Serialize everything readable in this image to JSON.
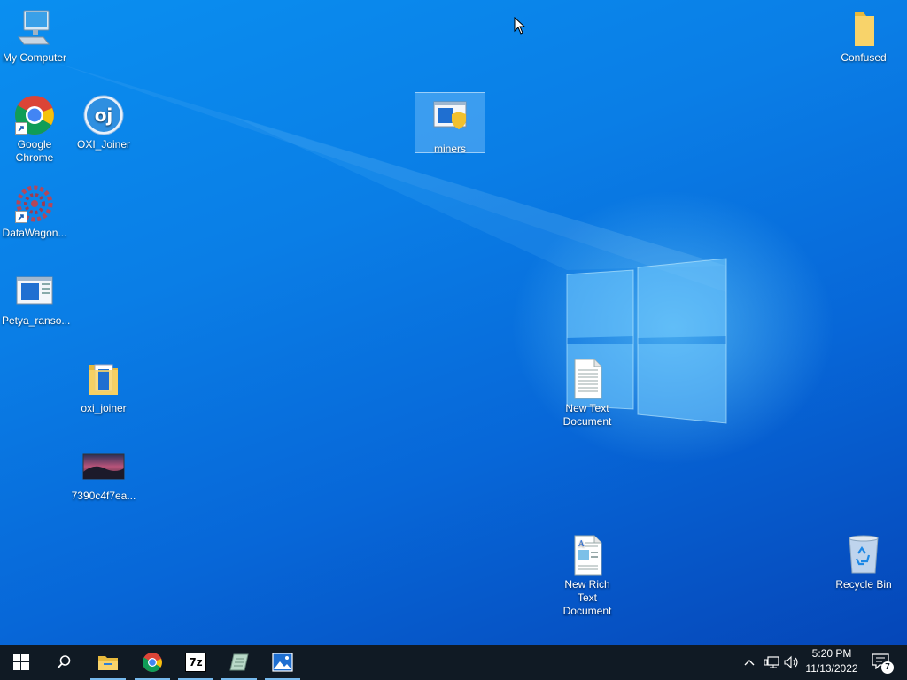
{
  "desktop": {
    "icons": {
      "my_computer": "My Computer",
      "confused": "Confused",
      "chrome": "Google Chrome",
      "oxi_joiner_app": "OXI_Joiner",
      "miners": "miners",
      "datawagon": "DataWagon...",
      "petya": "Petya_ranso...",
      "oxi_joiner_folder": "oxi_joiner",
      "image_file": "7390c4f7ea...",
      "new_text": "New Text Document",
      "new_rich_text": "New Rich Text Document",
      "recycle_bin": "Recycle Bin"
    },
    "oxi_badge": "oj"
  },
  "taskbar": {
    "apps": {
      "seven_zip": "7z"
    },
    "clock": {
      "time": "5:20 PM",
      "date": "11/13/2022"
    },
    "notifications_count": "7"
  },
  "colors": {
    "desktop_top": "#0a8ff0",
    "desktop_bottom": "#0546b8",
    "taskbar": "#101a24",
    "active_indicator": "#76b9ed"
  }
}
